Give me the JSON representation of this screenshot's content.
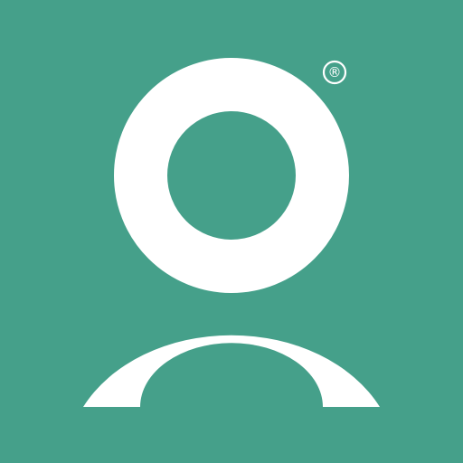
{
  "app_icon": {
    "name": "user-profile-logo",
    "background_color": "#45A08A",
    "foreground_color": "#FFFFFF",
    "registered_mark": "®",
    "icons": {
      "head": "ring-head-icon",
      "body": "arch-shoulders-icon",
      "trademark": "registered-trademark-icon"
    }
  }
}
